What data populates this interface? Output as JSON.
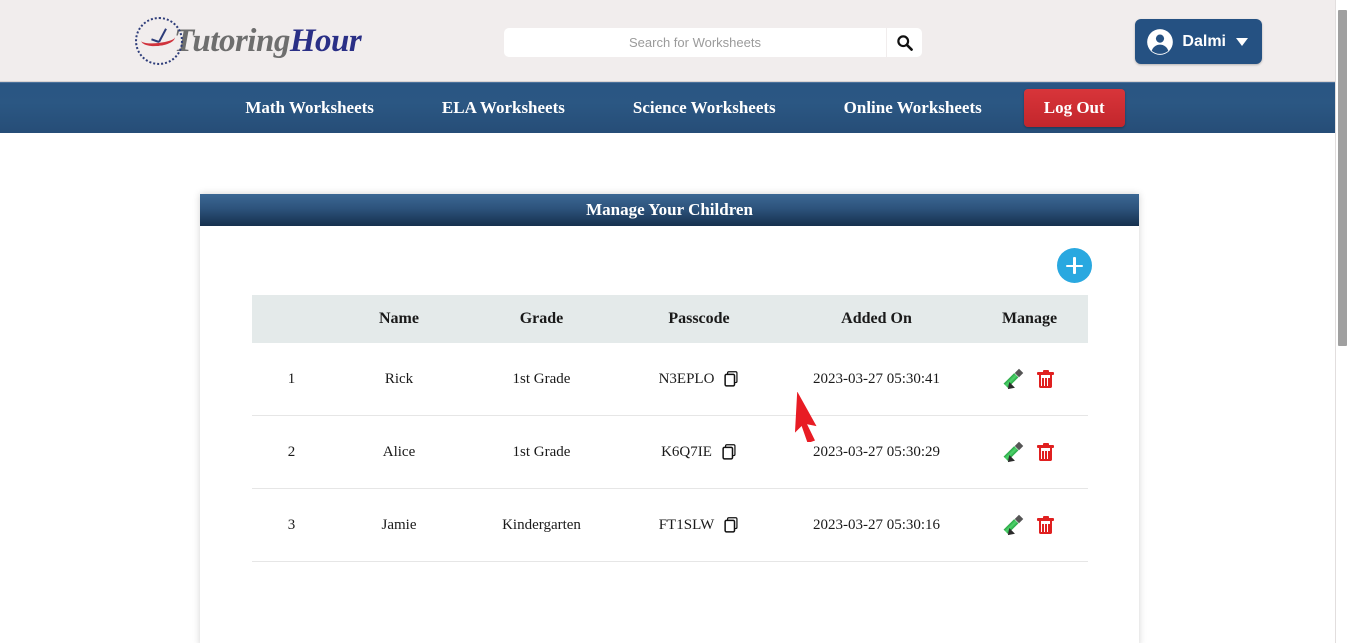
{
  "header": {
    "logo": {
      "text_part1": "Tutoring",
      "text_part2": "Hour",
      "icon": "clock-logo-icon"
    },
    "search": {
      "placeholder": "Search for Worksheets",
      "value": "",
      "button_icon": "search-icon"
    },
    "user": {
      "name": "Dalmi",
      "avatar_icon": "user-circle-icon",
      "caret_icon": "chevron-down-icon"
    }
  },
  "nav": {
    "links": [
      {
        "label": "Math Worksheets"
      },
      {
        "label": "ELA Worksheets"
      },
      {
        "label": "Science Worksheets"
      },
      {
        "label": "Online Worksheets"
      }
    ],
    "logout_label": "Log Out"
  },
  "panel": {
    "title": "Manage Your Children",
    "add_button_icon": "plus-icon",
    "table": {
      "columns": [
        "",
        "Name",
        "Grade",
        "Passcode",
        "Added On",
        "Manage"
      ],
      "rows": [
        {
          "index": "1",
          "name": "Rick",
          "grade": "1st Grade",
          "passcode": "N3EPLO",
          "copy_icon": "copy-icon",
          "added_on": "2023-03-27 05:30:41",
          "edit_icon": "pencil-icon",
          "delete_icon": "trash-icon"
        },
        {
          "index": "2",
          "name": "Alice",
          "grade": "1st Grade",
          "passcode": "K6Q7IE",
          "copy_icon": "copy-icon",
          "added_on": "2023-03-27 05:30:29",
          "edit_icon": "pencil-icon",
          "delete_icon": "trash-icon"
        },
        {
          "index": "3",
          "name": "Jamie",
          "grade": "Kindergarten",
          "passcode": "FT1SLW",
          "copy_icon": "copy-icon",
          "added_on": "2023-03-27 05:30:16",
          "edit_icon": "pencil-icon",
          "delete_icon": "trash-icon"
        }
      ]
    }
  },
  "cursor": {
    "icon": "mouse-pointer-arrow",
    "color": "#e81c24"
  },
  "colors": {
    "header_bg": "#f1eded",
    "nav_bg": "#2b5783",
    "panel_header_dark": "#16304e",
    "logout_red": "#c9292f",
    "add_blue": "#29a8e0",
    "table_header_bg": "#e4eaea",
    "edit_green": "#27a544",
    "delete_red": "#e02020"
  }
}
